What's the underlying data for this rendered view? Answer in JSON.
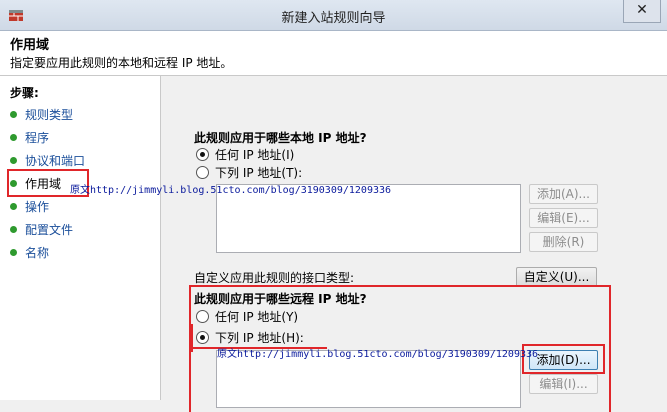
{
  "window": {
    "title": "新建入站规则向导",
    "close": "✕"
  },
  "header": {
    "title": "作用域",
    "description": "指定要应用此规则的本地和远程 IP 地址。"
  },
  "steps": {
    "title": "步骤:",
    "items": [
      {
        "label": "规则类型"
      },
      {
        "label": "程序"
      },
      {
        "label": "协议和端口"
      },
      {
        "label": "作用域"
      },
      {
        "label": "操作"
      },
      {
        "label": "配置文件"
      },
      {
        "label": "名称"
      }
    ]
  },
  "local": {
    "question": "此规则应用于哪些本地 IP 地址?",
    "any": "任何 IP 地址(I)",
    "these": "下列 IP 地址(T):",
    "selected": "any",
    "add": "添加(A)...",
    "edit": "编辑(E)...",
    "remove": "删除(R)"
  },
  "interface": {
    "label": "自定义应用此规则的接口类型:",
    "button": "自定义(U)..."
  },
  "remote": {
    "question": "此规则应用于哪些远程 IP 地址?",
    "any": "任何 IP 地址(Y)",
    "these": "下列 IP 地址(H):",
    "selected": "these",
    "add": "添加(D)...",
    "edit": "编辑(I)..."
  },
  "watermark": {
    "text": "原文http://jimmyli.blog.51cto.com/blog/3190309/1209336"
  },
  "colors": {
    "accent": "#e0262a",
    "step_link": "#1a4e9a",
    "step_dot": "#2e9a2e"
  }
}
